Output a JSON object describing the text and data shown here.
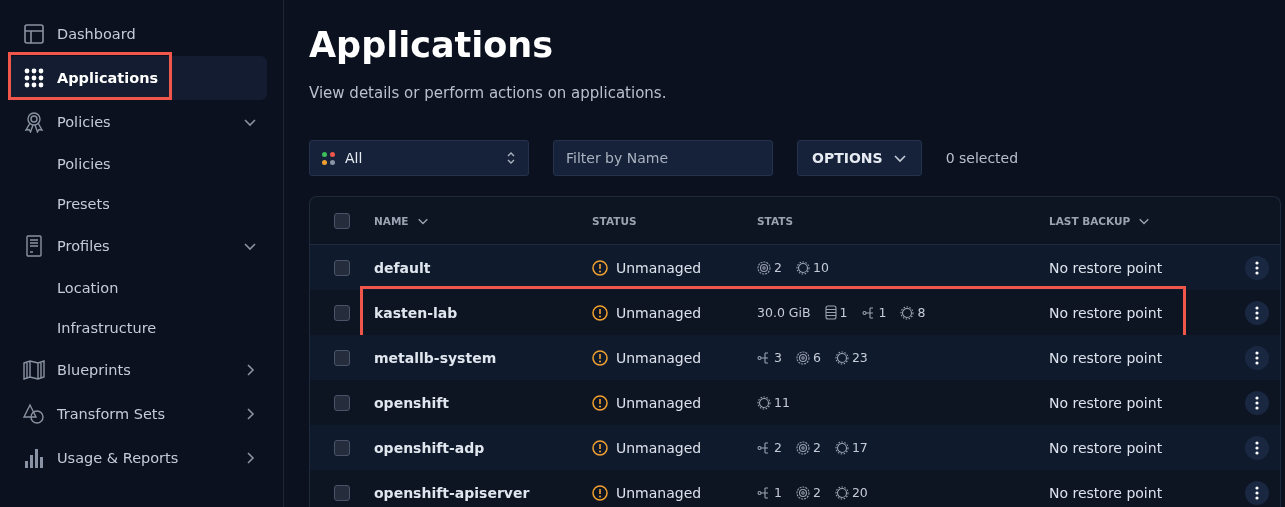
{
  "sidebar": {
    "items": [
      {
        "label": "Dashboard",
        "kind": "link",
        "selected": false,
        "highlighted": false
      },
      {
        "label": "Applications",
        "kind": "link",
        "selected": true,
        "highlighted": true
      },
      {
        "label": "Policies",
        "kind": "group",
        "expanded": true,
        "selected": false,
        "highlighted": false,
        "children": [
          {
            "label": "Policies"
          },
          {
            "label": "Presets"
          }
        ]
      },
      {
        "label": "Profiles",
        "kind": "group",
        "expanded": true,
        "selected": false,
        "highlighted": false,
        "children": [
          {
            "label": "Location"
          },
          {
            "label": "Infrastructure"
          }
        ]
      },
      {
        "label": "Blueprints",
        "kind": "group",
        "expanded": false,
        "selected": false,
        "highlighted": false
      },
      {
        "label": "Transform Sets",
        "kind": "group",
        "expanded": false,
        "selected": false,
        "highlighted": false
      },
      {
        "label": "Usage & Reports",
        "kind": "group",
        "expanded": false,
        "selected": false,
        "highlighted": false
      }
    ]
  },
  "page": {
    "title": "Applications",
    "subtitle": "View details or perform actions on applications."
  },
  "toolbar": {
    "filter_select": "All",
    "name_filter": {
      "placeholder": "Filter by Name"
    },
    "options_button": "OPTIONS",
    "selection_count": "0 selected"
  },
  "table": {
    "all_checked": false,
    "columns": [
      "NAME",
      "STATUS",
      "STATS",
      "LAST BACKUP"
    ],
    "rows": [
      {
        "name": "default",
        "status": "Unmanaged",
        "checked": false,
        "highlighted": false,
        "stats": [
          {
            "kind": "disk",
            "value": "2"
          },
          {
            "kind": "gear",
            "value": "10"
          }
        ],
        "last_backup": "No restore point"
      },
      {
        "name": "kasten-lab",
        "status": "Unmanaged",
        "checked": false,
        "highlighted": true,
        "stats": [
          {
            "kind": "size",
            "value": "30.0 GiB"
          },
          {
            "kind": "volume",
            "value": "1"
          },
          {
            "kind": "network",
            "value": "1"
          },
          {
            "kind": "gear",
            "value": "8"
          }
        ],
        "last_backup": "No restore point"
      },
      {
        "name": "metallb-system",
        "status": "Unmanaged",
        "checked": false,
        "highlighted": false,
        "stats": [
          {
            "kind": "network",
            "value": "3"
          },
          {
            "kind": "disk",
            "value": "6"
          },
          {
            "kind": "gear",
            "value": "23"
          }
        ],
        "last_backup": "No restore point"
      },
      {
        "name": "openshift",
        "status": "Unmanaged",
        "checked": false,
        "highlighted": false,
        "stats": [
          {
            "kind": "gear",
            "value": "11"
          }
        ],
        "last_backup": "No restore point"
      },
      {
        "name": "openshift-adp",
        "status": "Unmanaged",
        "checked": false,
        "highlighted": false,
        "stats": [
          {
            "kind": "network",
            "value": "2"
          },
          {
            "kind": "disk",
            "value": "2"
          },
          {
            "kind": "gear",
            "value": "17"
          }
        ],
        "last_backup": "No restore point"
      },
      {
        "name": "openshift-apiserver",
        "status": "Unmanaged",
        "checked": false,
        "highlighted": false,
        "stats": [
          {
            "kind": "network",
            "value": "1"
          },
          {
            "kind": "disk",
            "value": "2"
          },
          {
            "kind": "gear",
            "value": "20"
          }
        ],
        "last_backup": "No restore point"
      }
    ]
  }
}
